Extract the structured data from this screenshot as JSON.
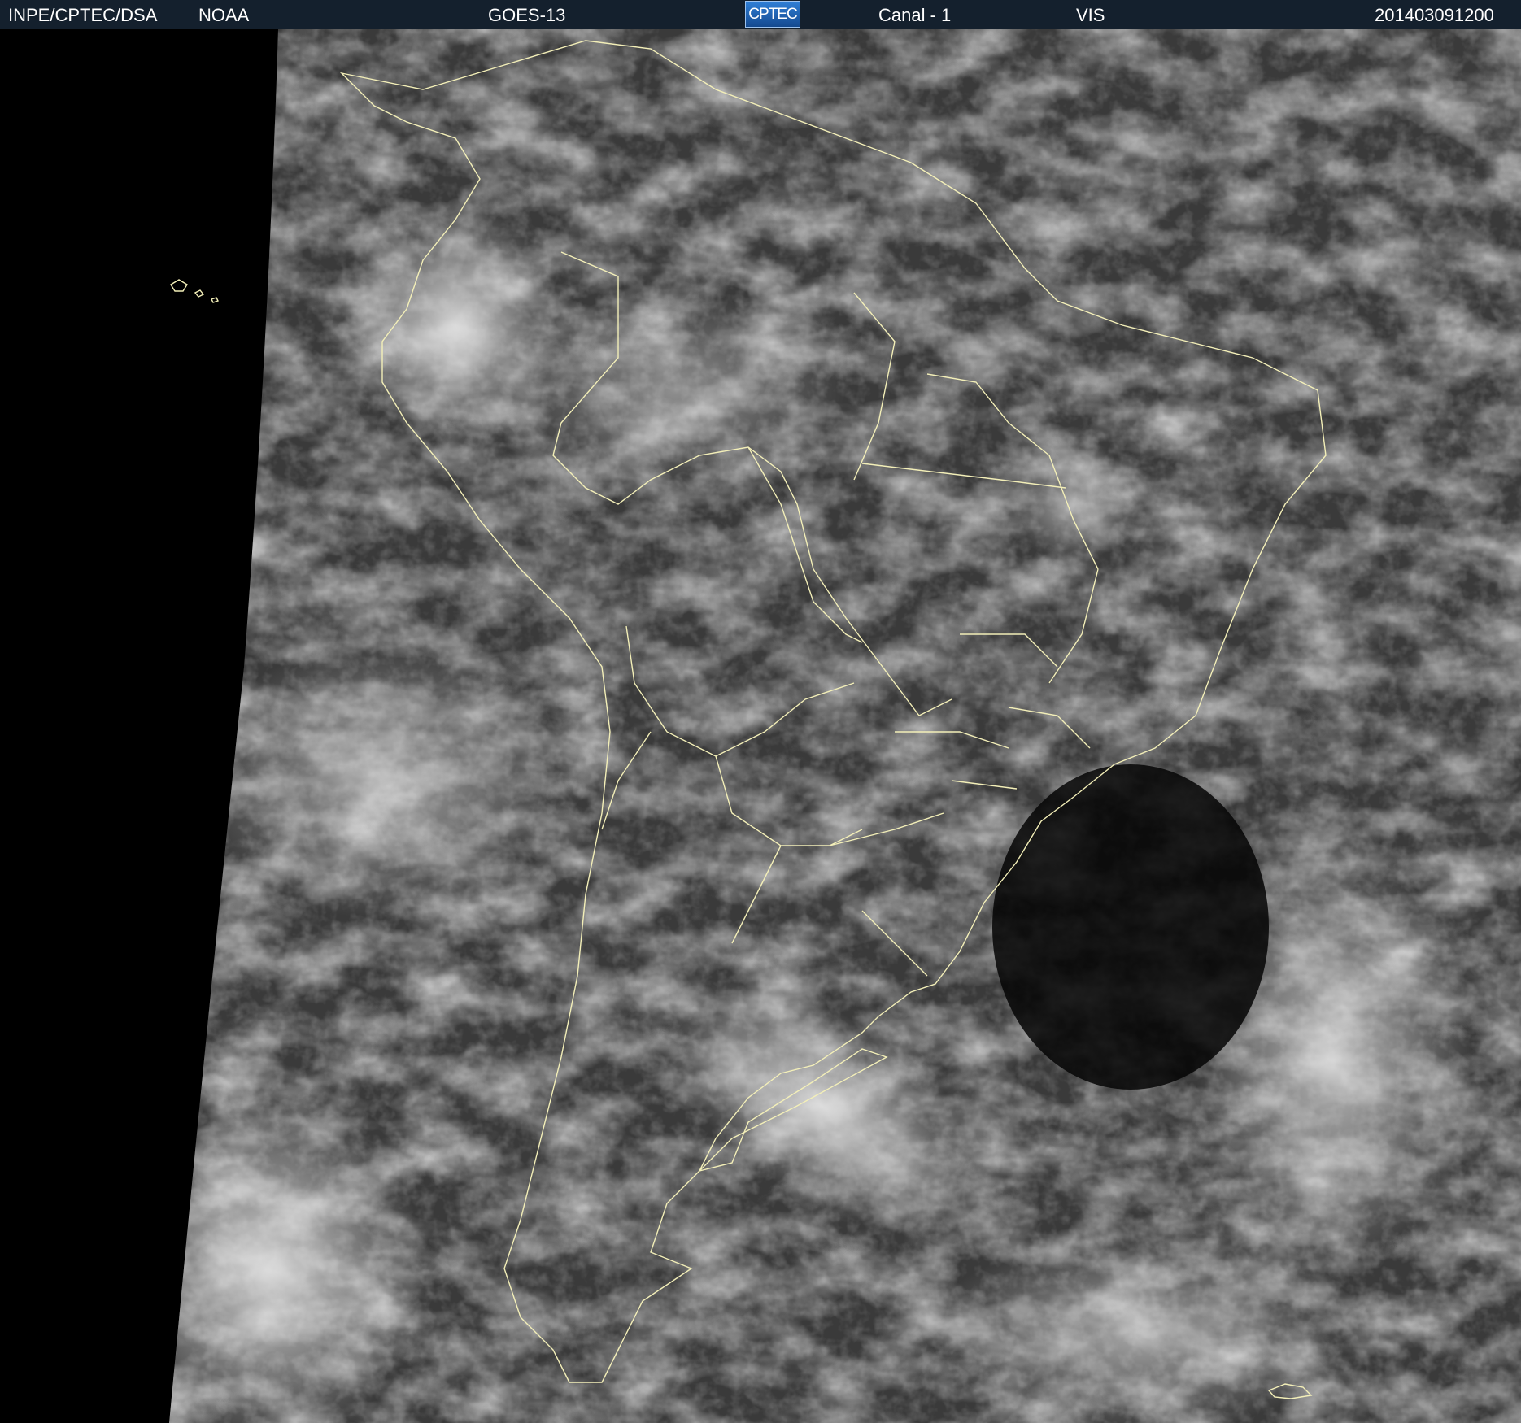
{
  "header": {
    "agency": "INPE/CPTEC/DSA",
    "source": "NOAA",
    "satellite": "GOES-13",
    "logo_text": "CPTEC",
    "channel": "Canal - 1",
    "band": "VIS",
    "timestamp": "201403091200"
  },
  "image": {
    "description_icon": "satellite-visible-image",
    "map_overlay_color": "#f3efb8",
    "background_color": "#000000",
    "header_color": "#14202d"
  }
}
